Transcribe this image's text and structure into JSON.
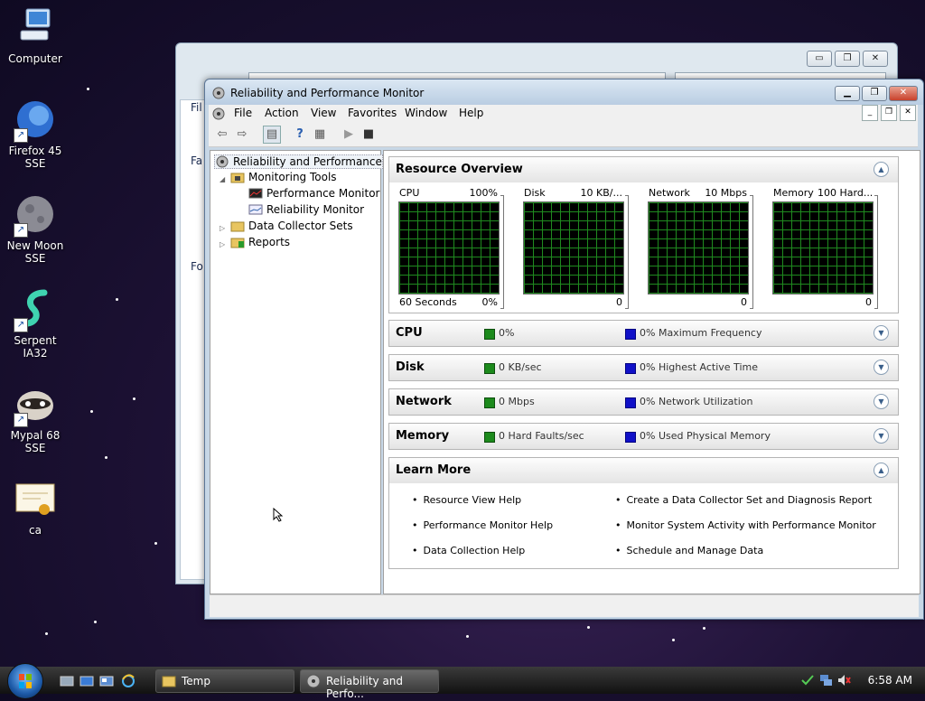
{
  "desktop": {
    "icons": [
      {
        "label": "Computer"
      },
      {
        "label": "Firefox 45 SSE"
      },
      {
        "label": "New Moon SSE"
      },
      {
        "label": "Serpent IA32"
      },
      {
        "label": "Mypal 68 SSE"
      },
      {
        "label": "ca"
      }
    ]
  },
  "bg_window": {
    "fragments": [
      "Fil",
      "Fa",
      "Fo"
    ],
    "buttons": {
      "minimize": "▭",
      "maximize": "❐",
      "close": "✕"
    }
  },
  "window": {
    "title": "Reliability and Performance Monitor",
    "buttons": {
      "minimize": "▁",
      "restore": "❐",
      "close": "✕"
    },
    "menu": [
      "File",
      "Action",
      "View",
      "Favorites",
      "Window",
      "Help"
    ],
    "mdi_buttons": [
      "_",
      "❐",
      "✕"
    ],
    "toolbar": {
      "back": "⇦",
      "forward": "⇨",
      "show_hide": "▤",
      "help": "?",
      "properties": "▦",
      "play": "▶",
      "stop": "■"
    }
  },
  "tree": {
    "root": "Reliability and Performance",
    "monitoring_tools": "Monitoring Tools",
    "performance_monitor": "Performance Monitor",
    "reliability_monitor": "Reliability Monitor",
    "data_collector_sets": "Data Collector Sets",
    "reports": "Reports"
  },
  "overview": {
    "title": "Resource Overview",
    "graphs": [
      {
        "name": "CPU",
        "max": "100%",
        "left_bottom": "60 Seconds",
        "right_bottom": "0%"
      },
      {
        "name": "Disk",
        "max": "10 KB/...",
        "left_bottom": "",
        "right_bottom": "0"
      },
      {
        "name": "Network",
        "max": "10 Mbps",
        "left_bottom": "",
        "right_bottom": "0"
      },
      {
        "name": "Memory",
        "max": "100 Hard...",
        "left_bottom": "",
        "right_bottom": "0"
      }
    ]
  },
  "sections": [
    {
      "title": "CPU",
      "green": "0%",
      "blue": "0% Maximum Frequency"
    },
    {
      "title": "Disk",
      "green": "0 KB/sec",
      "blue": "0% Highest Active Time"
    },
    {
      "title": "Network",
      "green": "0 Mbps",
      "blue": "0% Network Utilization"
    },
    {
      "title": "Memory",
      "green": "0 Hard Faults/sec",
      "blue": "0% Used Physical Memory"
    }
  ],
  "learn_more": {
    "title": "Learn More",
    "left": [
      "Resource View Help",
      "Performance Monitor Help",
      "Data Collection Help"
    ],
    "right": [
      "Create a Data Collector Set and Diagnosis Report",
      "Monitor System Activity with Performance Monitor",
      "Schedule and Manage Data"
    ]
  },
  "taskbar": {
    "tasks": [
      {
        "label": "Temp"
      },
      {
        "label": "Reliability and Perfo..."
      }
    ],
    "clock": "6:58 AM"
  },
  "colors": {
    "graph_bg": "#000000",
    "graph_grid": "#1f8a1f",
    "legend_green": "#1c8a1c",
    "legend_blue": "#1010c8"
  }
}
